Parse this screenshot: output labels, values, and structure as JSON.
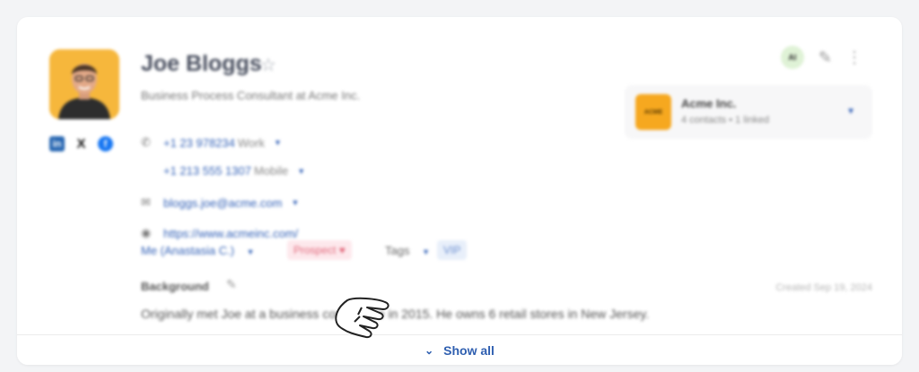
{
  "contact": {
    "name": "Joe Bloggs",
    "title": "Business Process Consultant at Acme Inc.",
    "phones": [
      {
        "number": "+1 23 978234",
        "label": "Work"
      },
      {
        "number": "+1 213 555 1307",
        "label": "Mobile"
      }
    ],
    "email": "bloggs.joe@acme.com",
    "website": "https://www.acmeinc.com/",
    "owner": "Me (Anastasia C.)",
    "status": "Prospect",
    "tags_label": "Tags",
    "tag": "VIP"
  },
  "background": {
    "label": "Background",
    "created": "Created Sep 19, 2024",
    "text": "Originally met Joe at a business conference in 2015. He owns 6 retail stores in New Jersey."
  },
  "company": {
    "name": "Acme Inc.",
    "meta": "4 contacts • 1 linked",
    "logo_text": "ACME"
  },
  "social": {
    "linkedin": "in",
    "x": "X",
    "facebook": "f"
  },
  "toolbar": {
    "ai_badge": "AI"
  },
  "footer": {
    "show_all": "Show all"
  },
  "colors": {
    "accent": "#2f5fb0",
    "avatar_bg": "#f6b73c",
    "prospect_bg": "#fde8ec",
    "vip_bg": "#e8effa"
  }
}
